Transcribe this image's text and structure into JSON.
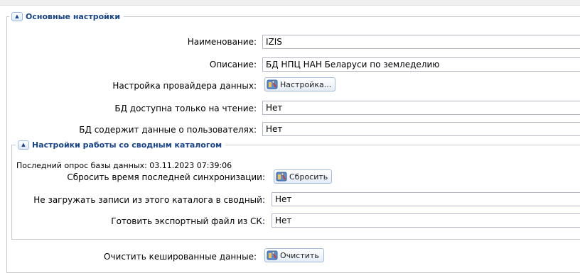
{
  "main": {
    "legend": "Основные настройки",
    "name_label": "Наименование:",
    "name_value": "IZIS",
    "description_label": "Описание:",
    "description_value": "БД НПЦ НАН Беларуси по земледелию",
    "provider_label": "Настройка провайдера данных:",
    "provider_button": "Настройка...",
    "readonly_label": "БД доступна только на чтение:",
    "readonly_value": "Нет",
    "userdata_label": "БД содержит данные о пользователях:",
    "userdata_value": "Нет"
  },
  "catalog": {
    "legend": "Настройки работы со сводным каталогом",
    "last_poll": "Последний опрос базы данных: 03.11.2023 07:39:06",
    "reset_label": "Сбросить время последней синхронизации:",
    "reset_button": "Сбросить",
    "noload_label": "Не загружать записи из этого каталога в сводный:",
    "noload_value": "Нет",
    "export_label": "Готовить экспортный файл из СК:",
    "export_value": "Нет"
  },
  "cache": {
    "clear_label": "Очистить кешированные данные:",
    "clear_button": "Очистить"
  },
  "icons": {
    "collapse": "collapse-up-icon",
    "tool": "toolbox-icon"
  },
  "colors": {
    "legend_text": "#15428b",
    "field_border": "#b5b8c8",
    "button_border": "#a3bad9"
  }
}
